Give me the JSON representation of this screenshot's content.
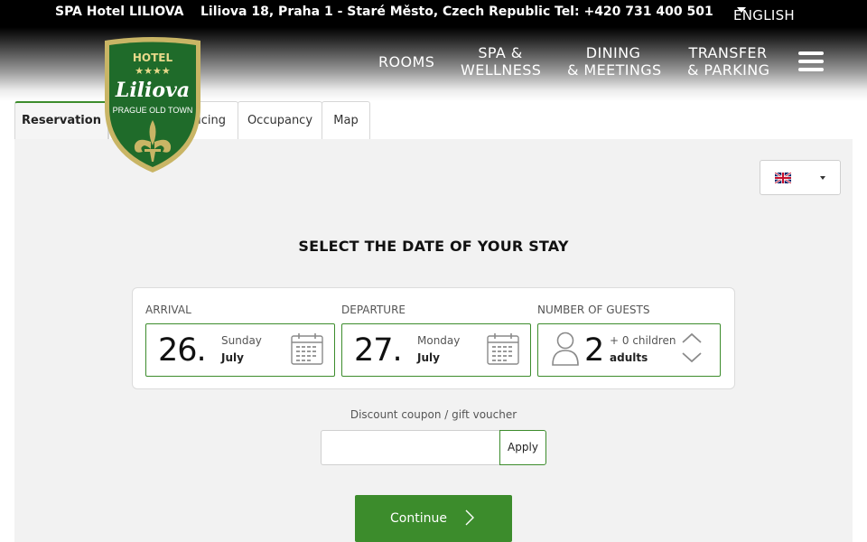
{
  "topbar": {
    "hotel_name": "SPA Hotel LILIOVA",
    "address": "Liliova 18, Praha 1 - Staré Město, Czech Republic",
    "phone": "Tel: +420 731 400 501",
    "language": "ENGLISH"
  },
  "nav": {
    "rooms": "ROOMS",
    "spa_line1": "SPA &",
    "spa_line2": "WELLNESS",
    "dining_line1": "DINING",
    "dining_line2": "& MEETINGS",
    "transfer_line1": "TRANSFER",
    "transfer_line2": "& PARKING"
  },
  "logo": {
    "top": "HOTEL",
    "stars": "★★★★",
    "name": "Liliova",
    "sub": "PRAGUE OLD TOWN"
  },
  "tabs": [
    {
      "label": "Reservation"
    },
    {
      "label": "Pricing"
    },
    {
      "label": "Occupancy"
    },
    {
      "label": "Map"
    }
  ],
  "booking": {
    "heading": "SELECT THE DATE OF YOUR STAY",
    "arrival": {
      "label": "ARRIVAL",
      "day": "26.",
      "weekday": "Sunday",
      "month": "July"
    },
    "departure": {
      "label": "DEPARTURE",
      "day": "27.",
      "weekday": "Monday",
      "month": "July"
    },
    "guests": {
      "label": "NUMBER OF GUESTS",
      "count": "2",
      "children": "+ 0 children",
      "adults": "adults"
    },
    "coupon_label": "Discount coupon / gift voucher",
    "coupon_value": "",
    "apply_label": "Apply",
    "continue_label": "Continue"
  },
  "colors": {
    "accent_green": "#3c8c2c",
    "panel_bg": "#f2f2f2",
    "logo_green": "#1f6b2a",
    "logo_gold": "#c9b565"
  },
  "icons": [
    "hamburger-icon",
    "calendar-icon",
    "user-icon",
    "chevron-up-icon",
    "chevron-down-icon",
    "arrow-right-icon",
    "uk-flag-icon",
    "fleur-de-lis-icon"
  ]
}
